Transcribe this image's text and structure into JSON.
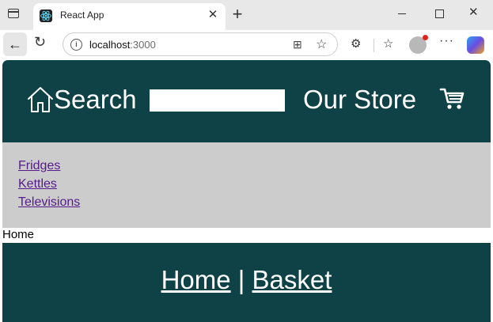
{
  "browser": {
    "tab_title": "React App",
    "url_host": "localhost",
    "url_port": ":3000"
  },
  "header": {
    "search_label": "Search",
    "search_value": "",
    "store_title": "Our Store"
  },
  "categories": [
    {
      "label": "Fridges"
    },
    {
      "label": "Kettles"
    },
    {
      "label": "Televisions"
    }
  ],
  "breadcrumb": "Home",
  "footer": {
    "home_link": "Home",
    "separator": "|",
    "basket_link": "Basket"
  },
  "colors": {
    "header_bg": "#0f4246",
    "category_bg": "#cccccc",
    "link_visited": "#551a8b"
  }
}
